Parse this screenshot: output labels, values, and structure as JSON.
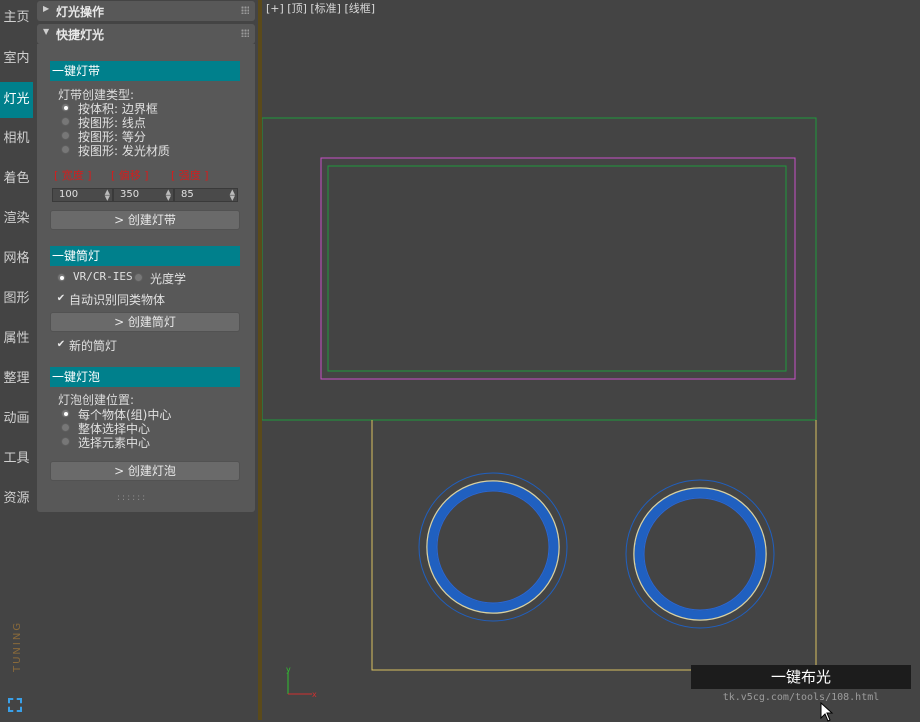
{
  "nav": {
    "items": [
      "主页",
      "室内",
      "灯光",
      "相机",
      "着色",
      "渲染",
      "网格",
      "图形",
      "属性",
      "整理",
      "动画",
      "工具",
      "资源"
    ],
    "active_index": 2,
    "brand_text": "TUNING"
  },
  "panel": {
    "rollout1_title": "灯光操作",
    "rollout2_title": "快捷灯光",
    "strip": {
      "header": "一键灯带",
      "type_label": "灯带创建类型:",
      "options": [
        "按体积: 边界框",
        "按图形: 线点",
        "按图形: 等分",
        "按图形: 发光材质"
      ],
      "selected_option": 0,
      "param_labels": [
        "[ 宽度 ]",
        "[ 偏移 ]",
        "[ 强度 ]"
      ],
      "param_values": [
        "100",
        "350",
        "85"
      ],
      "button": "> 创建灯带"
    },
    "spot": {
      "header": "一键筒灯",
      "radio1": "VR/CR-IES",
      "radio2": "光度学",
      "checkbox_auto": "自动识别同类物体",
      "button": "> 创建筒灯",
      "checkbox_new": "新的筒灯"
    },
    "bulb": {
      "header": "一键灯泡",
      "pos_label": "灯泡创建位置:",
      "options": [
        "每个物体(组)中心",
        "整体选择中心",
        "选择元素中心"
      ],
      "selected_option": 0,
      "button": "> 创建灯泡"
    }
  },
  "viewport": {
    "label": "[+] [顶] [标准] [线框]",
    "axis_x": "x",
    "axis_y": "y"
  },
  "overlay": {
    "caption": "一键布光",
    "url": "tk.v5cg.com/tools/108.html"
  },
  "colors": {
    "accent": "#00808c",
    "green_frame": "#1e9a3c",
    "magenta_frame": "#c850c8",
    "yellow_frame": "#d8c060",
    "ring_blue": "#2060c0"
  }
}
